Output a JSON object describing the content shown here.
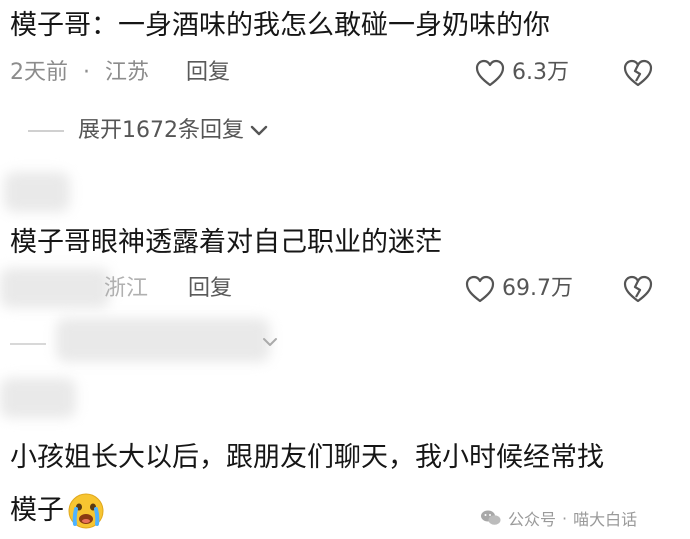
{
  "comments": [
    {
      "text": "模子哥：一身酒味的我怎么敢碰一身奶味的你",
      "time": "2天前",
      "sep": "·",
      "location": "江苏",
      "reply_label": "回复",
      "likes": "6.3万",
      "expand_label": "展开1672条回复"
    },
    {
      "text": "模子哥眼神透露着对自己职业的迷茫",
      "location": "浙江",
      "reply_label": "回复",
      "likes": "69.7万"
    },
    {
      "text_line1": "小孩姐长大以后，跟朋友们聊天，我小时候经常找",
      "text_line2": "模子"
    }
  ],
  "watermark": {
    "sep": "·",
    "source": "公众号",
    "name": "喵大白话"
  },
  "icons": {
    "like": "heart-outline-icon",
    "dislike": "broken-heart-icon",
    "chevron": "chevron-down-icon",
    "emoji": "crying-face-emoji-icon",
    "wechat": "wechat-logo-icon"
  }
}
